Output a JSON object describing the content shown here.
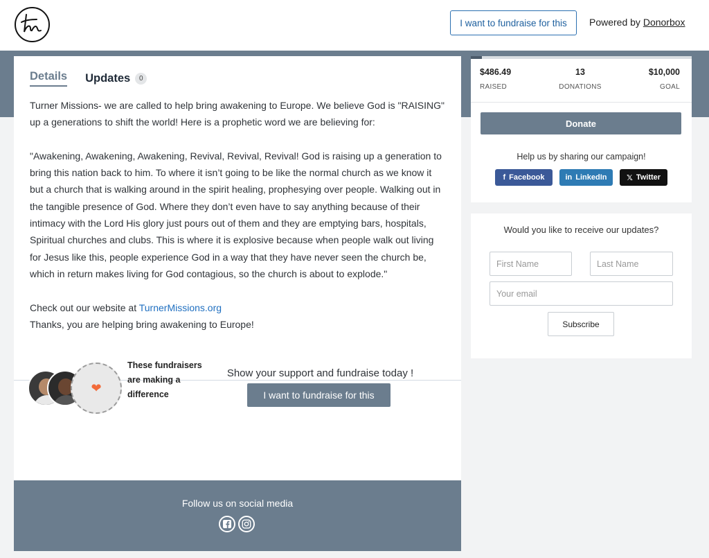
{
  "header": {
    "fundraise_button": "I want to fundraise for this",
    "powered_by": "Powered by",
    "brand": "Donorbox"
  },
  "tabs": {
    "details": "Details",
    "updates": "Updates",
    "updates_count": "0"
  },
  "description": {
    "p1": "Turner Missions- we are called to help bring awakening to Europe. We believe God is \"RAISING\" up a generations to shift the world! Here is a prophetic word we are believing for:",
    "p2": "\"Awakening, Awakening, Awakening, Revival, Revival, Revival! God is raising up a generation to bring this nation back to him. To where it isn’t going to be like the normal church as we know it but a church that is walking around in the spirit healing, prophesying over people. Walking out in the tangible presence of God. Where they don’t even have to say anything because of their intimacy with the Lord His glory just pours out of them and they are emptying bars, hospitals, Spiritual churches and clubs. This is where it is explosive because when people walk out living for Jesus like this, people experience God in a way that they have never seen the church be, which in return makes living for God contagious, so the church is about to explode.\"",
    "website_prefix": "Check out our website at",
    "website_link": "TurnerMissions.org",
    "thanks": "Thanks, you are helping bring awakening to Europe!"
  },
  "fundraisers": {
    "text": "These fundraisers are making a difference",
    "support": "Show your support and fundraise today !",
    "button": "I want to fundraise for this"
  },
  "footer": {
    "follow": "Follow us on social media",
    "icons": [
      "facebook-icon",
      "instagram-icon"
    ]
  },
  "stats": {
    "raised": "$486.49",
    "raised_label": "RAISED",
    "donations": "13",
    "donations_label": "DONATIONS",
    "goal": "$10,000",
    "goal_label": "GOAL",
    "progress_percent": 4.9
  },
  "donate_button": "Donate",
  "share": {
    "title": "Help us by sharing our campaign!",
    "facebook": "Facebook",
    "linkedin": "LinkedIn",
    "twitter": "Twitter"
  },
  "subscribe": {
    "title": "Would you like to receive our updates?",
    "first_name_placeholder": "First Name",
    "last_name_placeholder": "Last Name",
    "email_placeholder": "Your email",
    "button": "Subscribe"
  },
  "colors": {
    "accent": "#6b7d8e",
    "link": "#1f6fc0",
    "facebook": "#3b5998",
    "linkedin": "#2e7bb4",
    "twitter": "#111111",
    "heart": "#f26b3a"
  }
}
